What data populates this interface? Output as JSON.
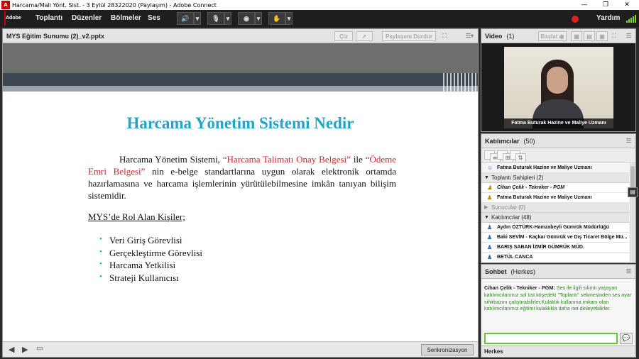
{
  "window": {
    "app_icon": "A",
    "title": "Harcama/Mali Yönt. Sist. - 3 Eylül 28322020 (Paylaşım) - Adobe Connect",
    "minimize": "—",
    "maximize": "❐",
    "close": "✕"
  },
  "menubar": {
    "logo_text": "Adobe",
    "items": [
      "Toplantı",
      "Düzenler",
      "Bölmeler",
      "Ses"
    ],
    "help": "Yardım"
  },
  "share": {
    "title": "MYS Eğitim Sunumu (2)_v2.pptx",
    "draw_label": "Çiz",
    "stop_label": "Paylaşımı Durdur",
    "sync_label": "Senkronizasyon",
    "slide": {
      "heading": "Harcama Yönetim Sistemi Nedir",
      "para_a": "Harcama Yönetim Sistemi, ",
      "para_red1": "“Harcama Talimatı Onay Belgesi”",
      "para_b": " ile ",
      "para_red2": "“Ödeme Emri Belgesi”",
      "para_c": " nin e-belge standartlarına uygun olarak elektronik ortamda hazırlamasına ve harcama işlemlerinin yürütülebilmesine imkân tanıyan bilişim sistemidir.",
      "subheading": "MYS’de Rol Alan Kişiler;",
      "roles": [
        "Veri Giriş Görevlisi",
        "Gerçekleştirme Görevlisi",
        "Harcama Yetkilisi",
        "Strateji Kullanıcısı"
      ]
    }
  },
  "video": {
    "title": "Video",
    "count": "(1)",
    "start_label": "Başlat",
    "caption": "Fatma Buturak Hazine ve Maliye Uzmanı"
  },
  "attendees": {
    "title": "Katılımcılar",
    "count": "(50)",
    "me": "Fatma Buturak Hazine ve Maliye Uzmanı",
    "hosts_header": "Toplantı Sahipleri (2)",
    "hosts": [
      "Cihan Çelik - Tekniker - PGM",
      "Fatma Buturak Hazine ve Maliye Uzmanı"
    ],
    "presenters_header": "Sunucular (0)",
    "participants_header": "Katılımcılar (48)",
    "participants": [
      "Aydın ÖZTÜRK-Hamzabeyli Gümrük Müdürlüğü",
      "Baki SEVİM - Kaçkar Gümrük ve Dış Ticaret Bölge Mü...",
      "BARIŞ SABAN İZMİR GÜMRÜK MÜD.",
      "BETÜL CANCA"
    ]
  },
  "chat": {
    "title": "Sohbet",
    "scope": "(Herkes)",
    "sender": "Cihan Çelik - Tekniker - PGM:",
    "message": "Ses ile ilgili sıkıntı yaşayan katılımcılarımız sol üst köşedeki \"Toplantı\" sekmesinden ses ayar sihirbazını çalıştırabilirler.Kulaklık kullanma imkanı olan katılımcılarımız eğitimi kulaklıkla daha net dinleyebilirler.",
    "tab": "Herkes"
  },
  "colors": {
    "accent_green": "#7cdc3c",
    "slide_title": "#1fa5c8",
    "slide_red": "#c8282d",
    "chat_text": "#2c8a1c"
  }
}
